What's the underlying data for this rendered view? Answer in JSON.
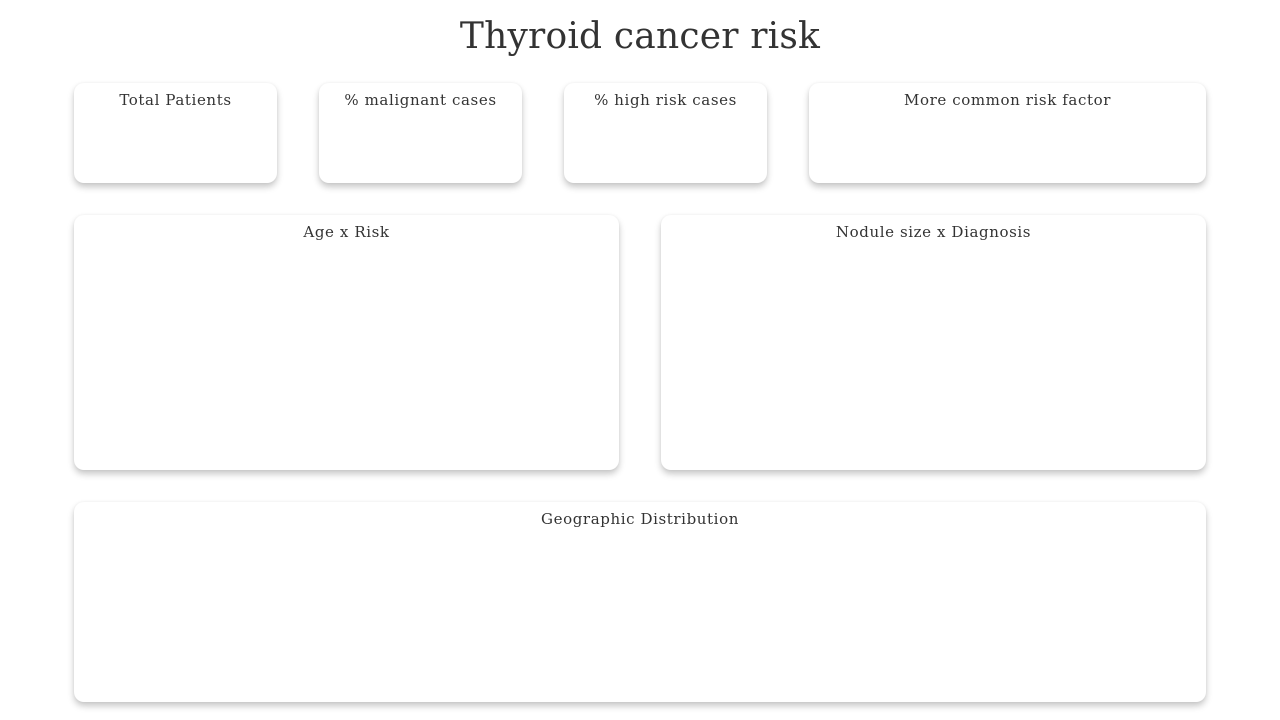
{
  "page": {
    "title": "Thyroid cancer risk"
  },
  "kpis": {
    "total_patients": {
      "label": "Total Patients"
    },
    "malignant_cases": {
      "label": "% malignant cases"
    },
    "high_risk_cases": {
      "label": "% high risk cases"
    },
    "common_risk_factor": {
      "label": "More common risk factor"
    }
  },
  "charts": {
    "age_risk": {
      "title": "Age x Risk"
    },
    "nodule_diagnosis": {
      "title": "Nodule size x Diagnosis"
    },
    "geographic": {
      "title": "Geographic Distribution"
    }
  }
}
